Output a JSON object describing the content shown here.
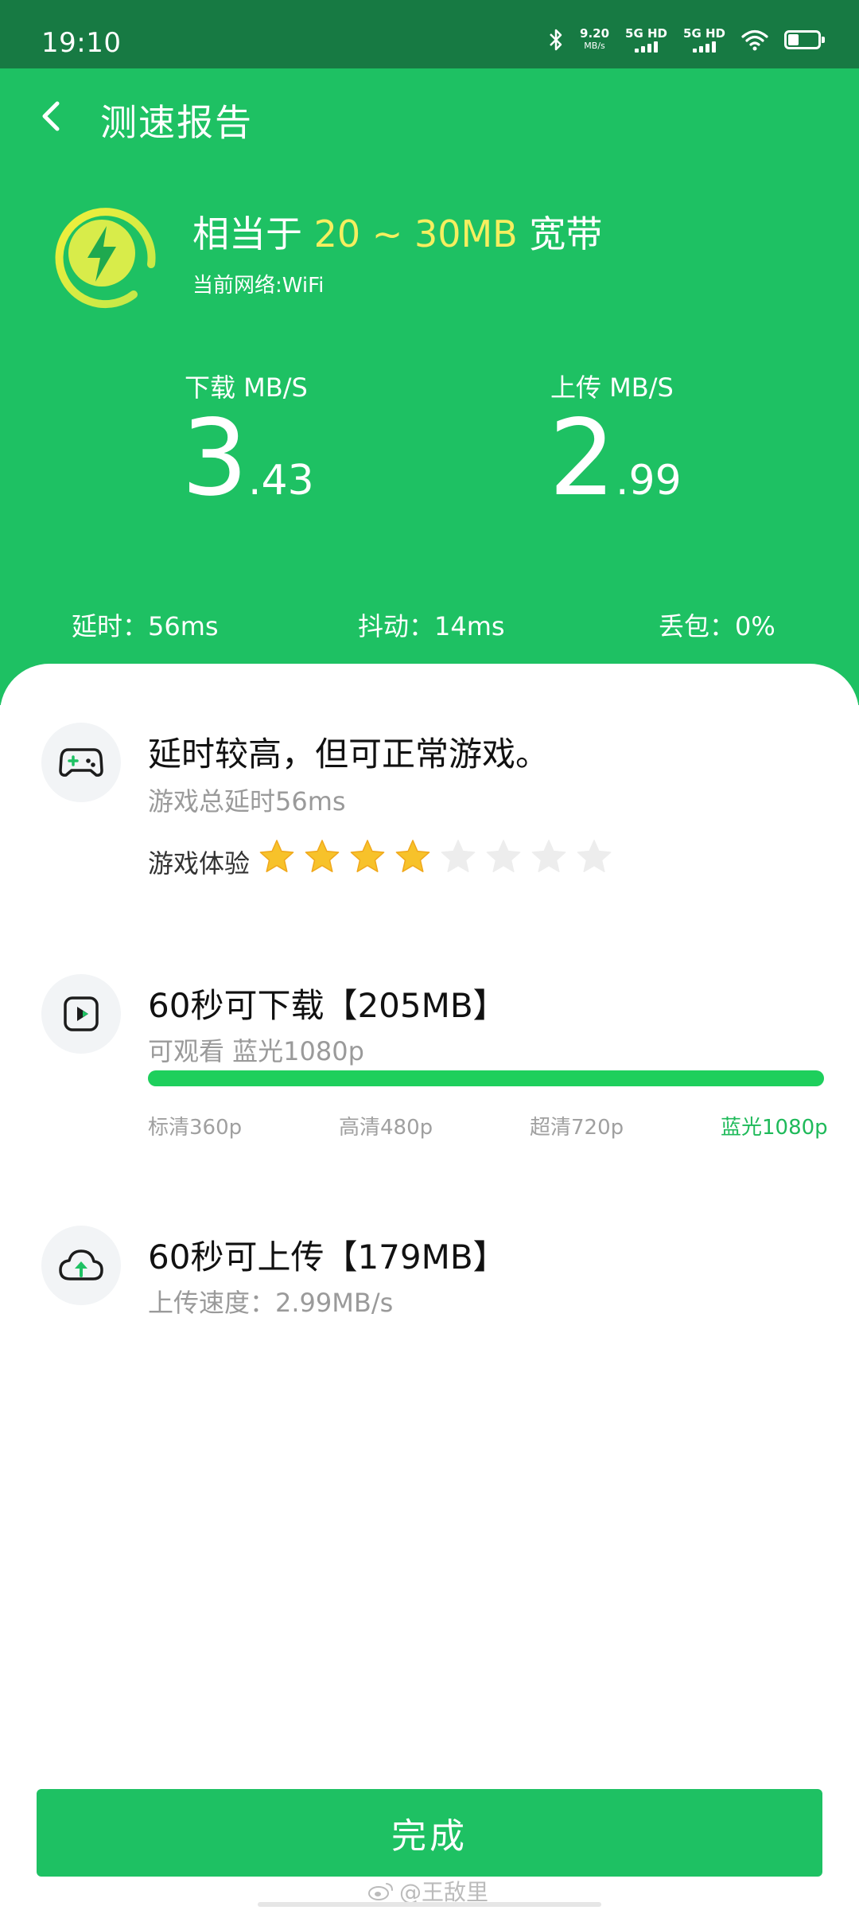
{
  "status_bar": {
    "time": "19:10",
    "net_speed_value": "9.20",
    "net_speed_unit": "MB/s",
    "sim1_label": "5G HD",
    "sim2_label": "5G HD",
    "battery_level": 0.35
  },
  "header": {
    "title": "测速报告",
    "bandwidth_prefix": "相当于 ",
    "bandwidth_value": "20 ~ 30MB",
    "bandwidth_suffix": " 宽带",
    "network_label": "当前网络:WiFi",
    "colors": {
      "accent_green": "#1ec163",
      "highlight_yellow": "#f5ef5f"
    }
  },
  "speed": {
    "download": {
      "label": "下载 MB/S",
      "int": "3",
      "dec": ".43"
    },
    "upload": {
      "label": "上传 MB/S",
      "int": "2",
      "dec": ".99"
    }
  },
  "stats": {
    "latency": "延时：56ms",
    "jitter": "抖动：14ms",
    "loss": "丢包：0%"
  },
  "game": {
    "icon": "gamepad-icon",
    "title": "延时较高，但可正常游戏。",
    "subtitle": "游戏总延时56ms",
    "rating_label": "游戏体验",
    "rating": 4,
    "rating_max": 8
  },
  "download_section": {
    "icon": "video-play-icon",
    "title": "60秒可下载【205MB】",
    "subtitle": "可观看 蓝光1080p",
    "progress": 1.0,
    "qualities": [
      "标清360p",
      "高清480p",
      "超清720p",
      "蓝光1080p"
    ]
  },
  "upload_section": {
    "icon": "cloud-upload-icon",
    "title": "60秒可上传【179MB】",
    "subtitle": "上传速度：2.99MB/s"
  },
  "footer": {
    "done_label": "完成",
    "watermark": "@王敌里"
  }
}
